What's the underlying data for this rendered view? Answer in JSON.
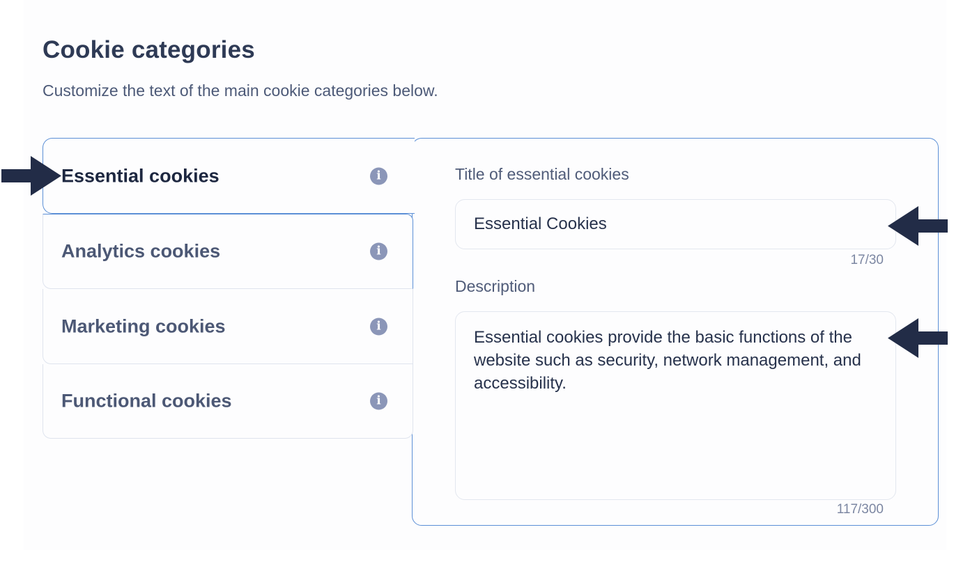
{
  "header": {
    "title": "Cookie categories",
    "subtitle": "Customize the text of the main cookie categories below."
  },
  "categories": [
    {
      "label": "Essential cookies",
      "info_icon": "info-icon",
      "active": true
    },
    {
      "label": "Analytics cookies",
      "info_icon": "info-icon",
      "active": false
    },
    {
      "label": "Marketing cookies",
      "info_icon": "info-icon",
      "active": false
    },
    {
      "label": "Functional cookies",
      "info_icon": "info-icon",
      "active": false
    }
  ],
  "editor": {
    "title_label": "Title of essential cookies",
    "title_value": "Essential Cookies",
    "title_counter": "17/30",
    "description_label": "Description",
    "description_value": "Essential cookies provide the basic functions of the website such as security, network management, and accessibility.",
    "description_counter": "117/300"
  },
  "colors": {
    "accent_border": "#5b8fd6",
    "text_dark": "#2e3a55",
    "info_icon": "#8b96b8",
    "arrow": "#222c47"
  }
}
